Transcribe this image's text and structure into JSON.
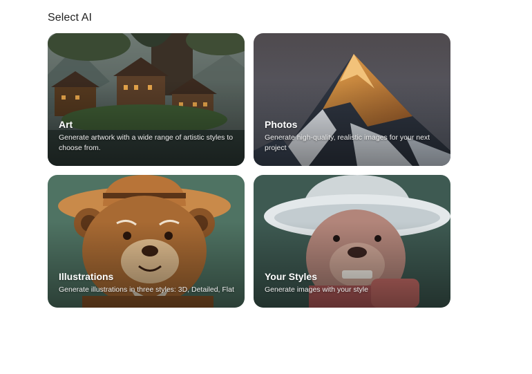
{
  "header": {
    "title": "Select AI"
  },
  "cards": [
    {
      "title": "Art",
      "description": "Generate artwork with a wide range of artistic styles to choose from.",
      "image": "fantasy-treehouse-village"
    },
    {
      "title": "Photos",
      "description": "Generate high-quality, realistic images for your next project",
      "image": "snowy-mountain-peak"
    },
    {
      "title": "Illustrations",
      "description": "Generate illustrations in three styles: 3D, Detailed, Flat",
      "image": "cowboy-teddy-bear"
    },
    {
      "title": "Your Styles",
      "description": "Generate images with your style",
      "image": "knitted-bear-with-hat"
    }
  ]
}
